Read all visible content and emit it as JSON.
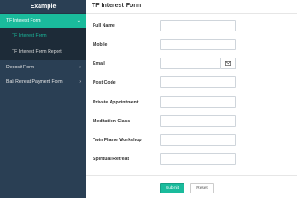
{
  "sidebar": {
    "title": "Example",
    "menu": [
      {
        "label": "TF Interest Form",
        "chevron": "⌄",
        "active": true
      },
      {
        "label": "Deposit Form",
        "chevron": "›",
        "active": false
      },
      {
        "label": "Bali Retreat Payment Form",
        "chevron": "›",
        "active": false
      }
    ],
    "submenu": [
      {
        "label": "TF Interest Form",
        "current": true
      },
      {
        "label": "TF Interest Form Report",
        "current": false
      }
    ]
  },
  "form": {
    "title": "TF Interest Form",
    "fields": [
      {
        "label": "Full Name",
        "value": ""
      },
      {
        "label": "Mobile",
        "value": ""
      },
      {
        "label": "Email",
        "value": "",
        "addon_icon": "envelope-icon"
      },
      {
        "label": "Post Code",
        "value": ""
      },
      {
        "label": "Private Appointment",
        "value": ""
      },
      {
        "label": "Meditation Class",
        "value": ""
      },
      {
        "label": "Twin Flame Workshop",
        "value": ""
      },
      {
        "label": "Spiritual Retreat",
        "value": ""
      }
    ],
    "submit_label": "Submit",
    "reset_label": "Reset"
  },
  "colors": {
    "sidebar_bg": "#2a3f54",
    "accent": "#1abb9c",
    "submenu_bg": "#1d2b38"
  }
}
